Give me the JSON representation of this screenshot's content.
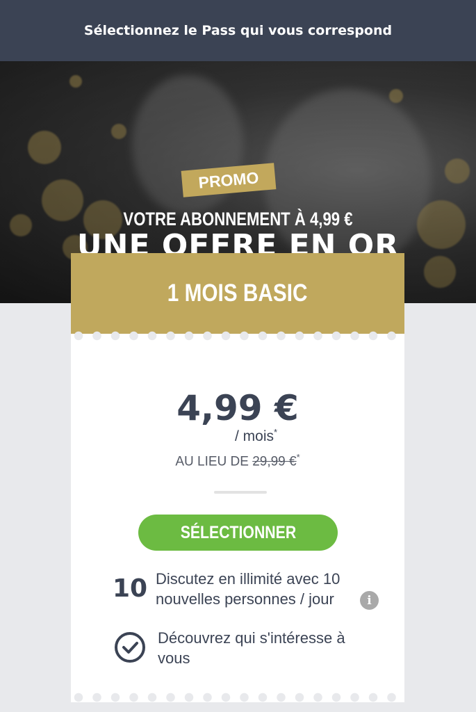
{
  "header": {
    "title": "Sélectionnez le Pass qui vous correspond"
  },
  "hero": {
    "badge": "PROMO",
    "line1": "VOTRE ABONNEMENT À 4,99 €",
    "line2": "UNE OFFRE EN OR"
  },
  "plan": {
    "name": "1 MOIS BASIC",
    "price": "4,99 €",
    "period": "/ mois",
    "period_mark": "*",
    "old_price_prefix": "AU LIEU DE",
    "old_price": "29,99 €",
    "old_price_mark": "*",
    "select_label": "SÉLECTIONNER"
  },
  "features": [
    {
      "number": "10",
      "text": "Discutez en illimité avec 10 nouvelles personnes / jour",
      "icon": "info-icon"
    },
    {
      "text": "Découvrez qui s'intéresse à vous",
      "icon": "check-circle-icon"
    }
  ],
  "colors": {
    "header_bg": "#3b4354",
    "gold": "#c0a85d",
    "button_green": "#6cbb42",
    "text_dark": "#3b4354",
    "page_bg": "#e8e9ec"
  }
}
